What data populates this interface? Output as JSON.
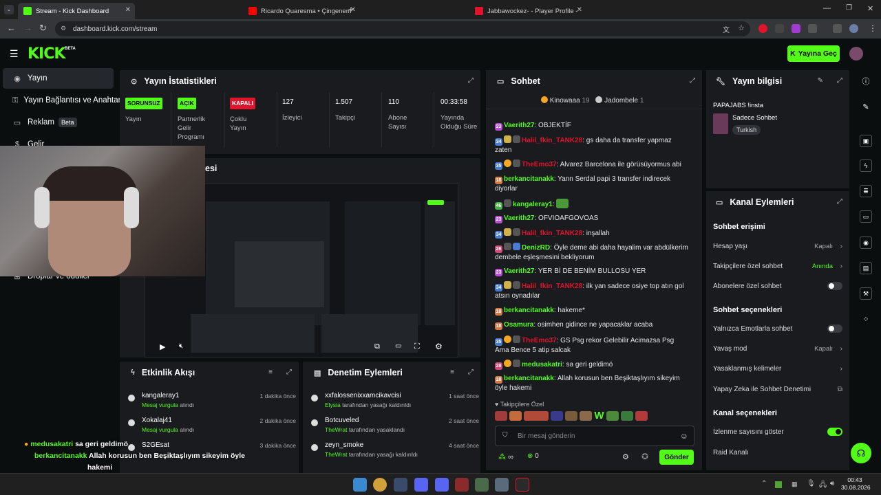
{
  "browser": {
    "tabs": [
      {
        "title": "Stream - Kick Dashboard",
        "color": "#53fc18"
      },
      {
        "title": "Ricardo Quaresma • Çingenem",
        "color": "#ff0000"
      },
      {
        "title": "Jabbawockez- - Player Profile -",
        "color": "#e0142c"
      }
    ],
    "url": "dashboard.kick.com/stream"
  },
  "header": {
    "logo": "KICK",
    "beta": "BETA",
    "go_live": "Yayına Geç"
  },
  "sidebar": {
    "items": [
      {
        "label": "Yayın",
        "icon": "broadcast-icon"
      },
      {
        "label": "Yayın Bağlantısı ve Anahtar",
        "icon": "key-icon"
      },
      {
        "label": "Reklam",
        "badge": "Beta",
        "icon": "ad-icon"
      },
      {
        "label": "Gelir",
        "icon": "money-icon"
      },
      {
        "label": "Droplar ve ödüller",
        "icon": "gift-icon"
      }
    ]
  },
  "stats": {
    "title": "Yayın İstatistikleri",
    "cells": [
      {
        "tag": "SORUNSUZ",
        "tag_color": "#53fc18",
        "label": "Yayın"
      },
      {
        "tag": "AÇIK",
        "tag_color": "#53fc18",
        "label": "Partnerlik Gelir Programı"
      },
      {
        "tag": "KAPALI",
        "tag_color": "#e0142c",
        "label": "Çoklu Yayın"
      },
      {
        "value": "127",
        "label": "İzleyici"
      },
      {
        "value": "1.507",
        "label": "Takipçi"
      },
      {
        "value": "110",
        "label": "Abone Sayısı"
      },
      {
        "value": "00:33:58",
        "label": "Yayında Olduğu Süre"
      }
    ]
  },
  "preview": {
    "title_fragment": "esi"
  },
  "activity": {
    "title": "Etkinlik Akışı",
    "items": [
      {
        "name": "kangaleray1",
        "sub": "Mesaj vurgula",
        "sub2": "alındı",
        "time": "1 dakika önce"
      },
      {
        "name": "Xokalaj41",
        "sub": "Mesaj vurgula",
        "sub2": "alındı",
        "time": "2 dakika önce"
      },
      {
        "name": "S2GEsat",
        "sub": "",
        "sub2": "",
        "time": "3 dakika önce"
      }
    ]
  },
  "moderation": {
    "title": "Denetim Eylemleri",
    "items": [
      {
        "name": "xxfalossenixxamcikavcisi",
        "by": "Elysia",
        "action": "tarafından yasağı kaldırıldı",
        "time": "1 saat önce"
      },
      {
        "name": "Botcuveled",
        "by": "TheWrat",
        "action": "tarafından yasaklandı",
        "time": "2 saat önce"
      },
      {
        "name": "zeyn_smoke",
        "by": "TheWrat",
        "action": "tarafından yasağı kaldırıldı",
        "time": "4 saat önce"
      }
    ]
  },
  "chat": {
    "title": "Sohbet",
    "pinned": [
      {
        "name": "Kinowaaa",
        "count": "19"
      },
      {
        "name": "Jadombele",
        "count": "1"
      }
    ],
    "messages": [
      {
        "badges": [
          "23"
        ],
        "user": "Vaerith27",
        "color": "#53fc18",
        "text": "OBJEKTİF"
      },
      {
        "badges": [
          "34"
        ],
        "user": "Halil_fkin_TANK28",
        "color": "#e0142c",
        "text": "gs daha da transfer yapmaz zaten"
      },
      {
        "badges": [
          "35"
        ],
        "user": "TheEmo37",
        "color": "#e0142c",
        "text": "Alvarez Barcelona ile görüsüyormus abi"
      },
      {
        "badges": [
          "18"
        ],
        "user": "berkancitanakk",
        "color": "#53fc18",
        "text": "Yann Serdal papi 3 transfer indirecek diyorlar"
      },
      {
        "badges": [
          "46"
        ],
        "user": "kangaleray1",
        "color": "#53fc18",
        "text": ""
      },
      {
        "badges": [
          "23"
        ],
        "user": "Vaerith27",
        "color": "#53fc18",
        "text": "OFVIOAFGOVOAS"
      },
      {
        "badges": [
          "34"
        ],
        "user": "Halil_fkin_TANK28",
        "color": "#e0142c",
        "text": "inşallah"
      },
      {
        "badges": [
          "26"
        ],
        "user": "DenizRD",
        "color": "#53fc18",
        "text": "Öyle deme abi daha hayalim var abdülkerim dembele eşleşmesini bekliyorum"
      },
      {
        "badges": [
          "23"
        ],
        "user": "Vaerith27",
        "color": "#53fc18",
        "text": "YER Bİ DE BENİM BULLOSU YER"
      },
      {
        "badges": [
          "34"
        ],
        "user": "Halil_fkin_TANK28",
        "color": "#e0142c",
        "text": "ilk yan sadece osiye top atın gol atsın oynadılar"
      },
      {
        "badges": [
          "18"
        ],
        "user": "berkancitanakk",
        "color": "#53fc18",
        "text": "hakeme*"
      },
      {
        "badges": [
          "18"
        ],
        "user": "Osamura",
        "color": "#53fc18",
        "text": "osimhen gidince ne yapacaklar acaba"
      },
      {
        "badges": [
          "35"
        ],
        "user": "TheEmo37",
        "color": "#e0142c",
        "text": "GS Psg rekor Gelebilir Acimazsa Psg Ama Bence 5 atip salcak"
      },
      {
        "badges": [
          "28"
        ],
        "user": "medusakatri",
        "color": "#53fc18",
        "text": "sa geri geldimö"
      },
      {
        "badges": [
          "18"
        ],
        "user": "berkancitanakk",
        "color": "#53fc18",
        "text": "Allah korusun ben Beşiktaşlıyım sikeyim öyle hakemi"
      }
    ],
    "followers_only": "Takipçilere Özel",
    "input_placeholder": "Bir mesaj gönderin",
    "points": "∞",
    "count": "0",
    "send": "Gönder"
  },
  "info": {
    "title": "Yayın bilgisi",
    "stream_title": "PAPAJABS !insta",
    "category": "Sadece Sohbet",
    "tag": "Turkish"
  },
  "channel": {
    "title": "Kanal Eylemleri",
    "chat_access": "Sohbet erişimi",
    "account_age": "Hesap yaşı",
    "account_age_val": "Kapalı",
    "followers_chat": "Takipçilere özel sohbet",
    "followers_chat_val": "Anında",
    "subs_chat": "Abonelere özel sohbet",
    "chat_options": "Sohbet seçenekleri",
    "emote_only": "Yalnızca Emotlarla sohbet",
    "slow_mode": "Yavaş mod",
    "slow_mode_val": "Kapalı",
    "banned_words": "Yasaklanmış kelimeler",
    "ai_mod": "Yapay Zeka ile Sohbet Denetimi",
    "channel_options": "Kanal seçenekleri",
    "show_viewers": "İzlenme sayısını göster",
    "raid": "Raid Kanalı"
  },
  "overlay": {
    "line1_user": "medusakatri",
    "line1_text": "sa geri geldimö",
    "line2_user": "berkancitanakk",
    "line2_text": "Allah korusun ben Beşiktaşlıyım sikeyim öyle",
    "line3": "hakemi"
  },
  "taskbar": {
    "time": "00:43",
    "date": "30.08.2026"
  }
}
